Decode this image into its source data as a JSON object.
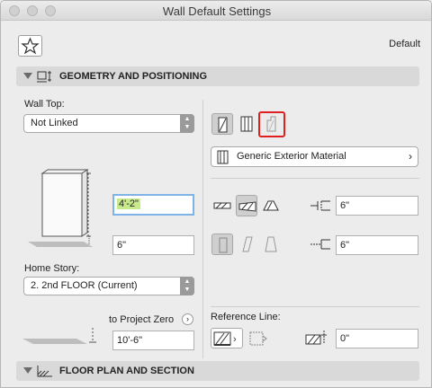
{
  "window": {
    "title": "Wall Default Settings"
  },
  "header": {
    "default_label": "Default"
  },
  "sections": {
    "geometry": "GEOMETRY AND POSITIONING",
    "floorplan": "FLOOR PLAN AND SECTION"
  },
  "geometry": {
    "wall_top_label": "Wall Top:",
    "wall_top_value": "Not Linked",
    "height_value": "4'-2\"",
    "base_offset_value": "6\"",
    "home_story_label": "Home Story:",
    "home_story_value": "2. 2nd FLOOR (Current)",
    "to_project_zero_label": "to Project Zero",
    "project_zero_value": "10'-6\"",
    "material_value": "Generic Exterior Material",
    "thickness_value": "6\"",
    "thickness2_value": "6\"",
    "reference_line_label": "Reference Line:",
    "ref_offset_value": "0\""
  }
}
